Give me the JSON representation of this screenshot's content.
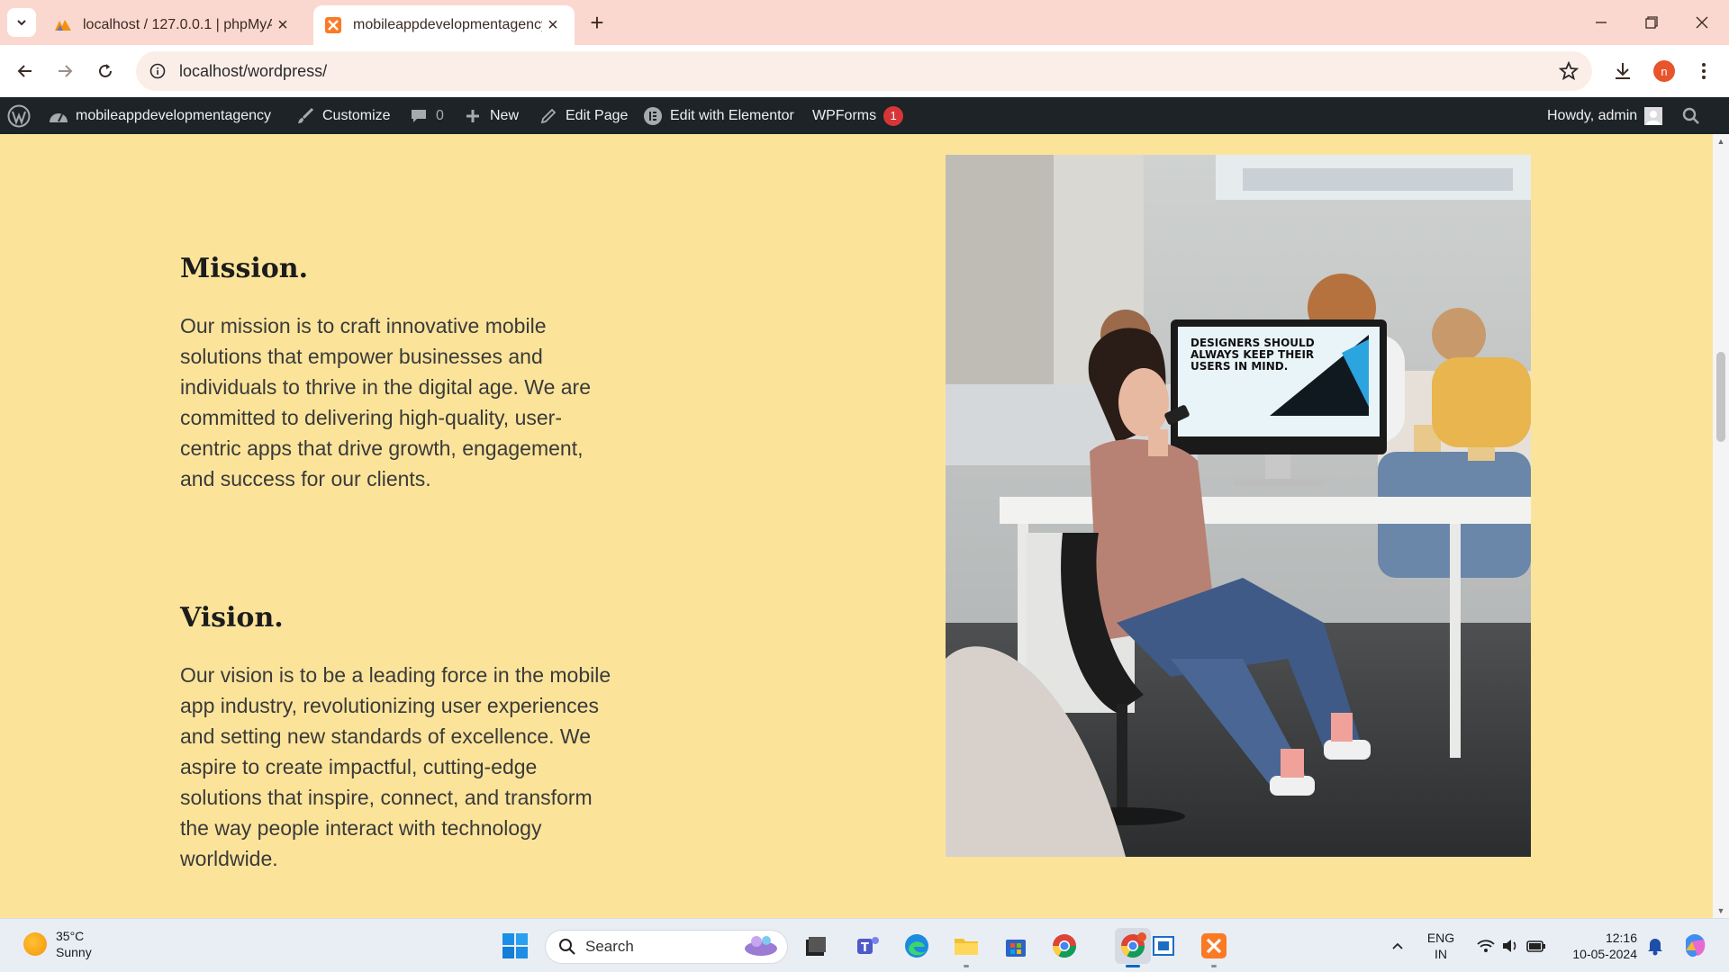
{
  "browser": {
    "tabs": [
      {
        "title": "localhost / 127.0.0.1 | phpMyAdmin",
        "active": false
      },
      {
        "title": "mobileappdevelopmentagency",
        "active": true
      }
    ],
    "url": "localhost/wordpress/",
    "profile_initial": "n"
  },
  "adminbar": {
    "site_name": "mobileappdevelopmentagency",
    "customize": "Customize",
    "comments_count": "0",
    "new": "New",
    "edit_page": "Edit Page",
    "edit_elementor": "Edit with Elementor",
    "wpforms": "WPForms",
    "wpforms_badge": "1",
    "howdy": "Howdy, admin"
  },
  "page": {
    "mission": {
      "title": "Mission.",
      "text": "Our mission is to craft innovative mobile solutions that empower businesses and individuals to thrive in the digital age. We are committed to delivering high-quality, user-centric apps that drive growth, engagement, and success for our clients."
    },
    "vision": {
      "title": "Vision.",
      "text": "Our vision is to be a leading force in the mobile app industry, revolutionizing user experiences and setting new standards of excellence. We aspire to create impactful, cutting-edge solutions that inspire, connect, and transform the way people interact with technology worldwide."
    },
    "image_screen_text": "DESIGNERS SHOULD ALWAYS KEEP THEIR USERS IN MIND."
  },
  "taskbar": {
    "temperature": "35°C",
    "weather": "Sunny",
    "search_placeholder": "Search",
    "lang_top": "ENG",
    "lang_bottom": "IN",
    "time": "12:16",
    "date": "10-05-2024"
  },
  "colors": {
    "page_background": "#fbe49a",
    "adminbar": "#1d2327",
    "tabstrip": "#fbd8cf",
    "accent": "#e8542b"
  }
}
